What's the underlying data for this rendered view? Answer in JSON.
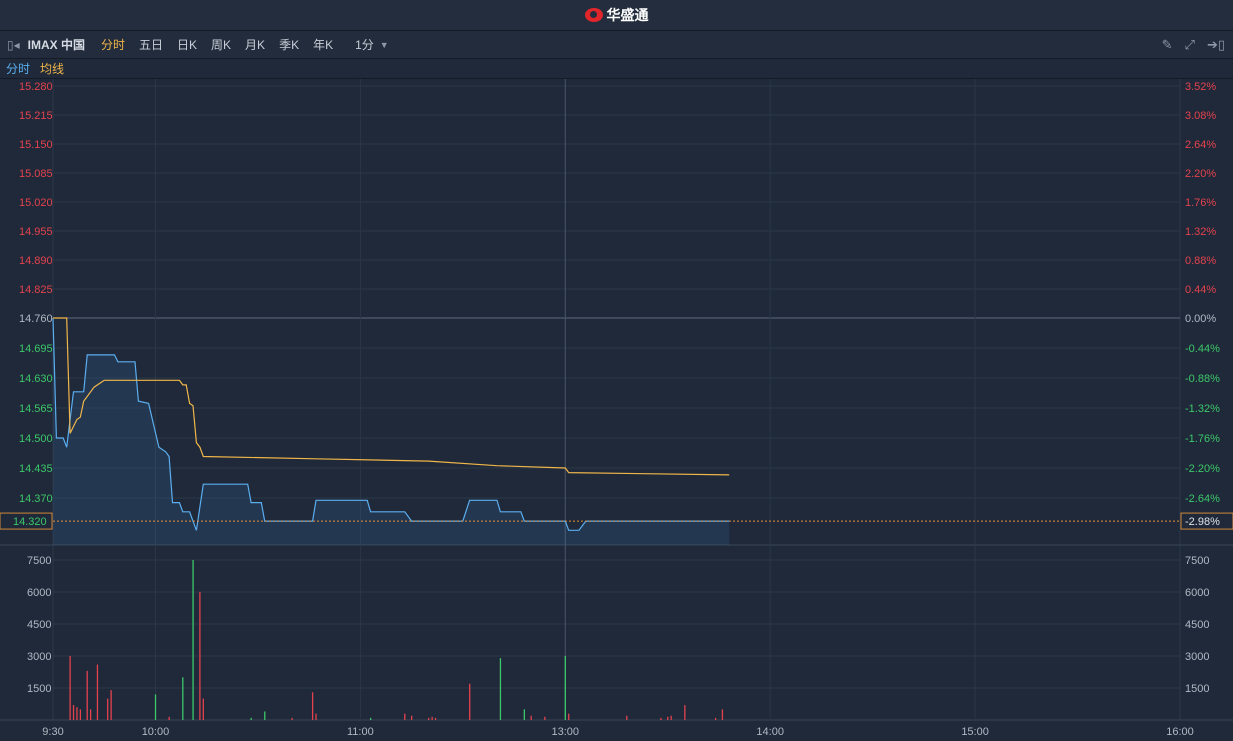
{
  "header": {
    "brand": "华盛通"
  },
  "toolbar": {
    "symbol": "IMAX 中国",
    "tabs": [
      "分时",
      "五日",
      "日K",
      "周K",
      "月K",
      "季K",
      "年K"
    ],
    "active_tab": "分时",
    "interval": "1分",
    "icons": [
      "collapse-icon",
      "pencil-icon",
      "fullscreen-icon",
      "exit-icon"
    ]
  },
  "legend": {
    "price": "分时",
    "avg": "均线"
  },
  "colors": {
    "price": "#5aaef0",
    "avg": "#f0b64a",
    "up": "#e5424d",
    "down": "#3cc86a",
    "flat": "#b0b8c4",
    "bg": "#1f2939",
    "grid": "#2b3647"
  },
  "last": {
    "price": "14.320",
    "pct": "-2.98%"
  },
  "chart_data": {
    "type": "line",
    "title": "IMAX 中国 分时",
    "prev_close": 14.76,
    "price_ticks": [
      "15.280",
      "15.215",
      "15.150",
      "15.085",
      "15.020",
      "14.955",
      "14.890",
      "14.825",
      "14.760",
      "14.695",
      "14.630",
      "14.565",
      "14.500",
      "14.435",
      "14.370"
    ],
    "pct_ticks": [
      "3.52%",
      "3.08%",
      "2.64%",
      "2.20%",
      "1.76%",
      "1.32%",
      "0.88%",
      "0.44%",
      "0.00%",
      "-0.44%",
      "-0.88%",
      "-1.32%",
      "-1.76%",
      "-2.20%",
      "-2.64%"
    ],
    "volume_ticks": [
      "7500",
      "6000",
      "4500",
      "3000",
      "1500"
    ],
    "time_ticks": [
      {
        "label": "9:30",
        "minute": 0
      },
      {
        "label": "10:00",
        "minute": 30
      },
      {
        "label": "11:00",
        "minute": 90
      },
      {
        "label": "13:00",
        "minute": 150
      },
      {
        "label": "14:00",
        "minute": 210
      },
      {
        "label": "15:00",
        "minute": 270
      },
      {
        "label": "16:00",
        "minute": 330
      }
    ],
    "total_minutes": 330,
    "price_series": [
      [
        0,
        14.76
      ],
      [
        1,
        14.5
      ],
      [
        3,
        14.5
      ],
      [
        4,
        14.48
      ],
      [
        6,
        14.6
      ],
      [
        9,
        14.6
      ],
      [
        10,
        14.68
      ],
      [
        18,
        14.68
      ],
      [
        19,
        14.665
      ],
      [
        24,
        14.665
      ],
      [
        25,
        14.58
      ],
      [
        28,
        14.575
      ],
      [
        31,
        14.48
      ],
      [
        33,
        14.47
      ],
      [
        34,
        14.46
      ],
      [
        35,
        14.36
      ],
      [
        37,
        14.36
      ],
      [
        38,
        14.34
      ],
      [
        40,
        14.34
      ],
      [
        42,
        14.3
      ],
      [
        44,
        14.4
      ],
      [
        57,
        14.4
      ],
      [
        58,
        14.36
      ],
      [
        61,
        14.36
      ],
      [
        62,
        14.32
      ],
      [
        76,
        14.32
      ],
      [
        77,
        14.365
      ],
      [
        92,
        14.365
      ],
      [
        93,
        14.34
      ],
      [
        103,
        14.34
      ],
      [
        105,
        14.32
      ],
      [
        120,
        14.32
      ],
      [
        122,
        14.365
      ],
      [
        130,
        14.365
      ],
      [
        131,
        14.34
      ],
      [
        137,
        14.34
      ],
      [
        138,
        14.32
      ],
      [
        150,
        14.32
      ],
      [
        151,
        14.3
      ],
      [
        154,
        14.3
      ],
      [
        156,
        14.32
      ],
      [
        198,
        14.32
      ]
    ],
    "avg_series": [
      [
        0,
        14.76
      ],
      [
        4,
        14.76
      ],
      [
        5,
        14.51
      ],
      [
        7,
        14.54
      ],
      [
        8,
        14.545
      ],
      [
        9,
        14.58
      ],
      [
        10,
        14.59
      ],
      [
        12,
        14.61
      ],
      [
        15,
        14.625
      ],
      [
        37,
        14.625
      ],
      [
        38,
        14.615
      ],
      [
        39,
        14.615
      ],
      [
        40,
        14.575
      ],
      [
        41,
        14.57
      ],
      [
        42,
        14.49
      ],
      [
        43,
        14.48
      ],
      [
        44,
        14.46
      ],
      [
        77,
        14.455
      ],
      [
        110,
        14.45
      ],
      [
        130,
        14.44
      ],
      [
        150,
        14.435
      ],
      [
        151,
        14.425
      ],
      [
        198,
        14.42
      ]
    ],
    "volume_series": [
      [
        5,
        3000,
        "up"
      ],
      [
        6,
        700,
        "up"
      ],
      [
        7,
        600,
        "up"
      ],
      [
        8,
        500,
        "up"
      ],
      [
        10,
        2300,
        "up"
      ],
      [
        11,
        500,
        "up"
      ],
      [
        13,
        2600,
        "up"
      ],
      [
        16,
        1000,
        "up"
      ],
      [
        17,
        1400,
        "up"
      ],
      [
        30,
        1200,
        "down"
      ],
      [
        34,
        150,
        "up"
      ],
      [
        38,
        2000,
        "down"
      ],
      [
        41,
        7500,
        "down"
      ],
      [
        43,
        6000,
        "up"
      ],
      [
        44,
        1000,
        "up"
      ],
      [
        58,
        100,
        "down"
      ],
      [
        62,
        400,
        "down"
      ],
      [
        70,
        100,
        "up"
      ],
      [
        76,
        1300,
        "up"
      ],
      [
        77,
        300,
        "up"
      ],
      [
        93,
        100,
        "down"
      ],
      [
        103,
        300,
        "up"
      ],
      [
        105,
        200,
        "up"
      ],
      [
        110,
        100,
        "up"
      ],
      [
        111,
        150,
        "up"
      ],
      [
        112,
        100,
        "up"
      ],
      [
        122,
        1700,
        "up"
      ],
      [
        131,
        2900,
        "down"
      ],
      [
        138,
        500,
        "down"
      ],
      [
        140,
        200,
        "up"
      ],
      [
        144,
        150,
        "up"
      ],
      [
        150,
        3000,
        "down"
      ],
      [
        151,
        300,
        "up"
      ],
      [
        168,
        200,
        "up"
      ],
      [
        178,
        100,
        "up"
      ],
      [
        180,
        150,
        "up"
      ],
      [
        181,
        200,
        "up"
      ],
      [
        185,
        700,
        "up"
      ],
      [
        194,
        100,
        "up"
      ],
      [
        196,
        500,
        "up"
      ]
    ],
    "volume_max": 7500
  }
}
